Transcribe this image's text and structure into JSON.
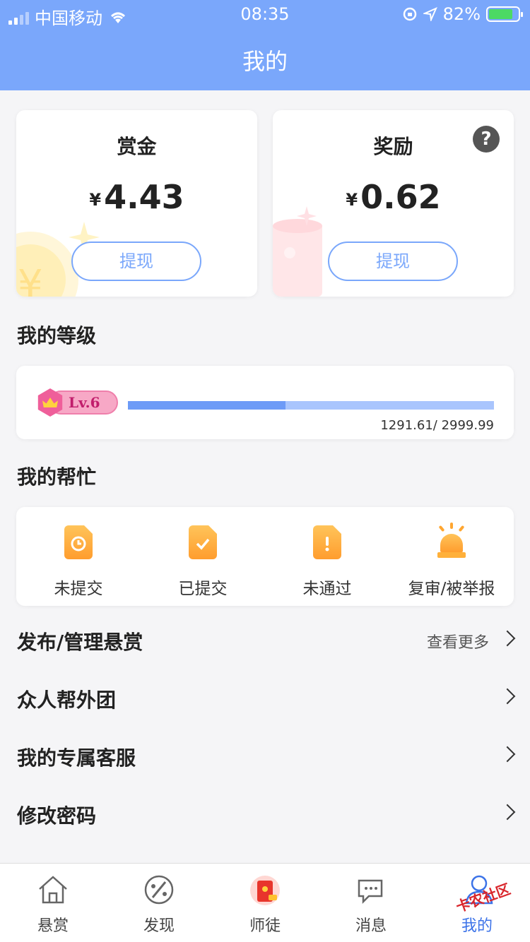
{
  "status_bar": {
    "carrier": "中国移动",
    "time": "08:35",
    "battery": "82%",
    "battery_level": 0.82,
    "icons": [
      "signal-icon",
      "wifi-icon",
      "rotation-lock-icon",
      "location-icon",
      "battery-charging-icon"
    ]
  },
  "header": {
    "title": "我的"
  },
  "bounty_card": {
    "title": "赏金",
    "currency": "¥",
    "amount": "4.43",
    "button": "提现"
  },
  "reward_card": {
    "title": "奖励",
    "currency": "¥",
    "amount": "0.62",
    "button": "提现",
    "help_glyph": "?"
  },
  "level_section": {
    "title": "我的等级",
    "badge": "Lv.6",
    "progress_text": "1291.61/ 2999.99",
    "progress_fraction": 0.43
  },
  "help_section": {
    "title": "我的帮忙",
    "items": [
      {
        "label": "未提交",
        "icon": "clock-document-icon"
      },
      {
        "label": "已提交",
        "icon": "check-document-icon"
      },
      {
        "label": "未通过",
        "icon": "exclamation-document-icon"
      },
      {
        "label": "复审/被举报",
        "icon": "alarm-light-icon"
      }
    ]
  },
  "menu": [
    {
      "label": "发布/管理悬赏",
      "more": "查看更多"
    },
    {
      "label": "众人帮外团"
    },
    {
      "label": "我的专属客服"
    },
    {
      "label": "修改密码"
    }
  ],
  "tabbar": {
    "items": [
      {
        "label": "悬赏",
        "icon": "home-icon"
      },
      {
        "label": "发现",
        "icon": "palette-icon"
      },
      {
        "label": "师徒",
        "icon": "red-envelope-icon"
      },
      {
        "label": "消息",
        "icon": "chat-icon"
      },
      {
        "label": "我的",
        "icon": "user-icon"
      }
    ],
    "active": 4
  },
  "watermark": "卡农社区",
  "colors": {
    "primary": "#7aa7fb",
    "active_tab": "#3c73e8",
    "accent_orange": "#ff9d2e"
  }
}
